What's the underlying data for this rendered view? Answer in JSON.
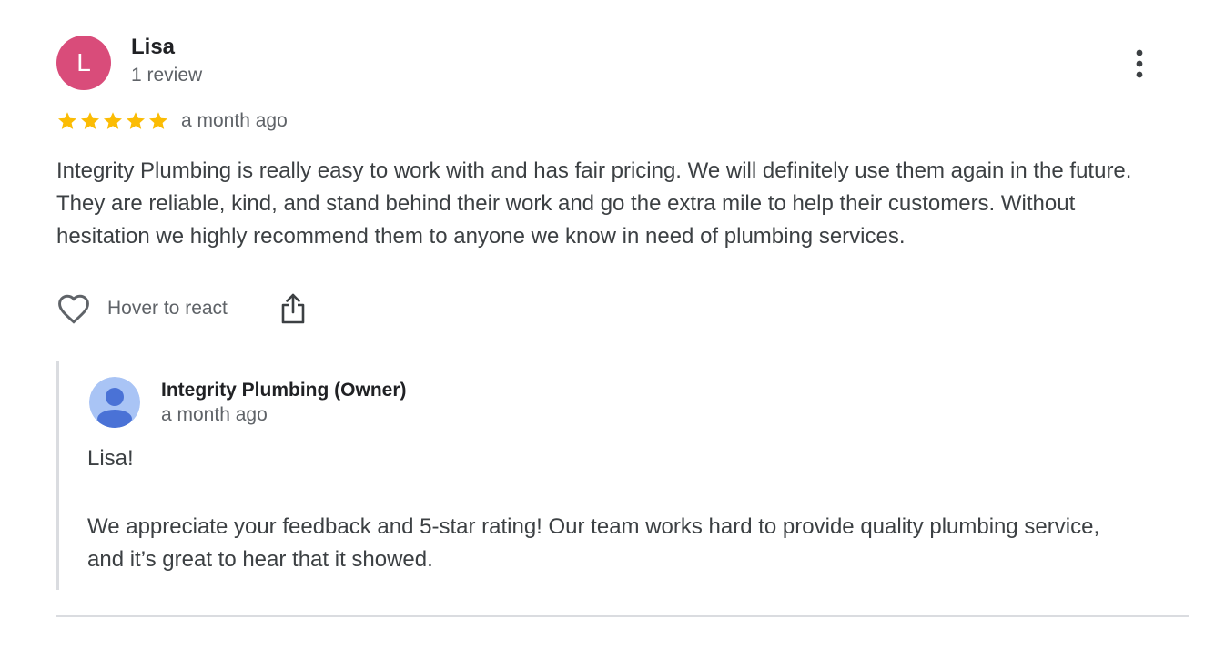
{
  "review": {
    "reviewer": {
      "initial": "L",
      "avatar_color": "#d94c7a",
      "name": "Lisa",
      "review_count": "1 review"
    },
    "rating": 5,
    "star_color": "#fbbc04",
    "time": "a month ago",
    "text": "Integrity Plumbing is really easy to work with and has fair pricing. We will definitely use them again in the future. They are reliable, kind, and stand behind their work and go the extra mile to help their customers. Without hesitation we highly recommend them to anyone we know in need of plumbing services.",
    "actions": {
      "react_label": "Hover to react",
      "react_icon": "heart-outline-icon",
      "share_icon": "share-icon",
      "more_icon": "more-vertical-icon"
    },
    "owner_reply": {
      "name": "Integrity Plumbing (Owner)",
      "time": "a month ago",
      "avatar_icon": "person-icon",
      "greeting": "Lisa!",
      "text": "We appreciate your feedback and 5-star rating! Our team works hard to provide quality plumbing service, and it’s great to hear that it showed."
    }
  }
}
